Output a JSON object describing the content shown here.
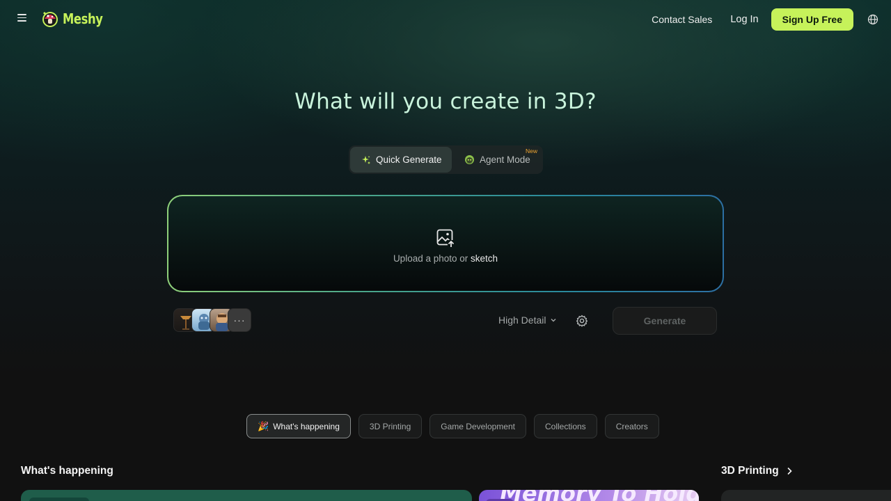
{
  "header": {
    "brand": "Meshy",
    "contact_sales": "Contact Sales",
    "login": "Log In",
    "signup": "Sign Up Free"
  },
  "hero": {
    "title": "What will you create in 3D?"
  },
  "modes": [
    {
      "label": "Quick Generate",
      "active": true,
      "icon": "sparkle-icon"
    },
    {
      "label": "Agent Mode",
      "active": false,
      "icon": "agent-icon",
      "badge": "New"
    }
  ],
  "upload": {
    "text_main": "Upload a photo",
    "text_or": " or ",
    "text_sketch": "sketch",
    "icon": "image-upload-icon"
  },
  "controls": {
    "more_label": "···",
    "detail_label": "High Detail",
    "generate_label": "Generate"
  },
  "chips": [
    {
      "label": "What's happening",
      "emoji": "🎉",
      "active": true
    },
    {
      "label": "3D Printing",
      "active": false
    },
    {
      "label": "Game Development",
      "active": false
    },
    {
      "label": "Collections",
      "active": false
    },
    {
      "label": "Creators",
      "active": false
    }
  ],
  "sections": {
    "whats_happening": "What's happening",
    "printing": "3D Printing",
    "card2_text": "Memory To Hold"
  },
  "colors": {
    "accent": "#c6f25a",
    "title": "#c9f3dc",
    "badge": "#f0a531"
  }
}
